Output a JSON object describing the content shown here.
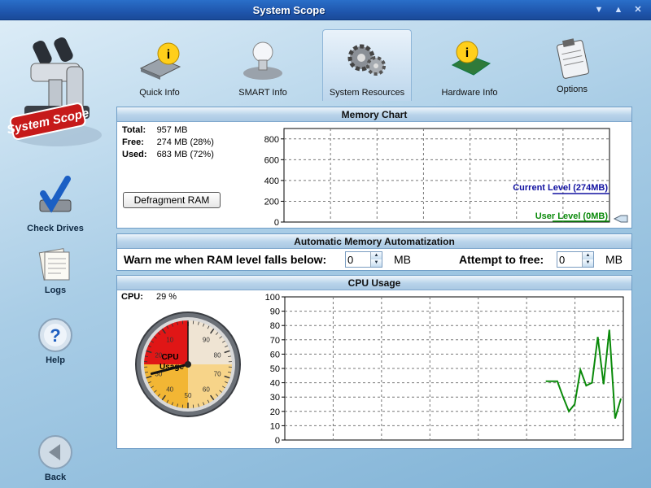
{
  "window": {
    "title": "System Scope"
  },
  "sidebar": {
    "logo_text": "System Scope",
    "items": [
      {
        "label": "Check Drives",
        "icon": "check-drives-icon"
      },
      {
        "label": "Logs",
        "icon": "logs-icon"
      },
      {
        "label": "Help",
        "icon": "help-icon"
      },
      {
        "label": "Back",
        "icon": "back-arrow-icon"
      }
    ]
  },
  "nav": {
    "items": [
      {
        "label": "Quick Info",
        "icon": "info-disk-icon"
      },
      {
        "label": "SMART Info",
        "icon": "smart-bulb-icon"
      },
      {
        "label": "System Resources",
        "icon": "gears-icon",
        "active": true
      },
      {
        "label": "Hardware Info",
        "icon": "info-board-icon"
      },
      {
        "label": "Options",
        "icon": "clipboard-icon"
      }
    ]
  },
  "memory": {
    "title": "Memory Chart",
    "stats": [
      {
        "key": "Total:",
        "value": "957 MB"
      },
      {
        "key": "Free:",
        "value": "274 MB (28%)"
      },
      {
        "key": "Used:",
        "value": "683 MB (72%)"
      }
    ],
    "defrag_label": "Defragment RAM",
    "current_level_label": "Current Level (274MB)",
    "user_level_label": "User Level (0MB)"
  },
  "automation": {
    "title": "Automatic Memory Automatization",
    "warn_label": "Warn me when RAM level falls below:",
    "warn_value": "0",
    "warn_unit": "MB",
    "attempt_label": "Attempt to free:",
    "attempt_value": "0",
    "attempt_unit": "MB"
  },
  "cpu": {
    "title": "CPU Usage",
    "label": "CPU:",
    "value": "29 %",
    "gauge_label_1": "CPU",
    "gauge_label_2": "Usage",
    "gauge_value": 29
  },
  "chart_data": [
    {
      "type": "line",
      "title": "Memory Chart",
      "ylim": [
        0,
        900
      ],
      "yticks": [
        0,
        200,
        400,
        600,
        800
      ],
      "grid": true,
      "series": [
        {
          "name": "Current Level (274MB)",
          "color": "#1010a0",
          "values": [
            274,
            274
          ]
        },
        {
          "name": "User Level (0MB)",
          "color": "#0a8a0a",
          "values": [
            0,
            0
          ]
        }
      ]
    },
    {
      "type": "line",
      "title": "CPU Usage",
      "ylim": [
        0,
        100
      ],
      "yticks": [
        0,
        10,
        20,
        30,
        40,
        50,
        60,
        70,
        80,
        90,
        100
      ],
      "grid": true,
      "series": [
        {
          "color": "#0a8a0a",
          "values": [
            41,
            41,
            41,
            30,
            20,
            25,
            49,
            38,
            40,
            72,
            39,
            77,
            15,
            29
          ]
        }
      ]
    },
    {
      "type": "gauge",
      "title": "CPU Usage",
      "value": 29,
      "ticks": [
        0,
        10,
        20,
        30,
        40,
        50,
        60,
        70,
        80,
        90
      ]
    }
  ]
}
